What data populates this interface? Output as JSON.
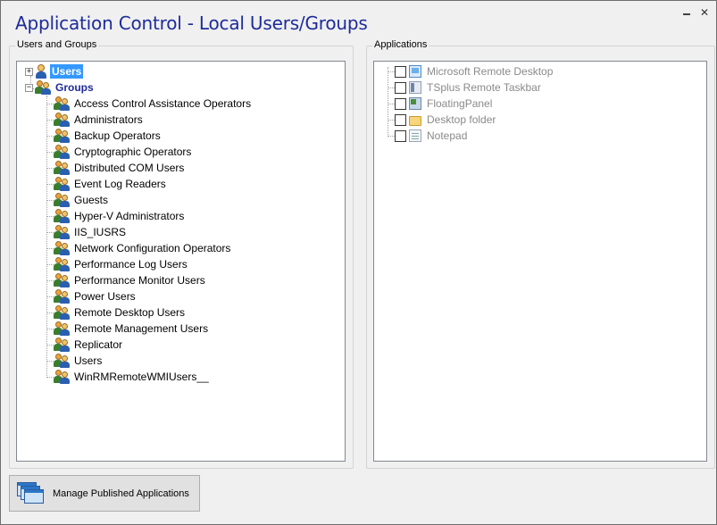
{
  "window": {
    "title": "Application Control - Local Users/Groups"
  },
  "users_groups": {
    "label": "Users and Groups",
    "users_node": "Users",
    "groups_node": "Groups",
    "groups": [
      "Access Control Assistance Operators",
      "Administrators",
      "Backup Operators",
      "Cryptographic Operators",
      "Distributed COM Users",
      "Event Log Readers",
      "Guests",
      "Hyper-V Administrators",
      "IIS_IUSRS",
      "Network Configuration Operators",
      "Performance Log Users",
      "Performance Monitor Users",
      "Power Users",
      "Remote Desktop Users",
      "Remote Management Users",
      "Replicator",
      "Users",
      "WinRMRemoteWMIUsers__"
    ]
  },
  "applications": {
    "label": "Applications",
    "items": [
      {
        "label": "Microsoft Remote Desktop",
        "icon": "remote-desktop-icon",
        "checked": false
      },
      {
        "label": "TSplus Remote Taskbar",
        "icon": "taskbar-icon",
        "checked": false
      },
      {
        "label": "FloatingPanel",
        "icon": "floating-panel-icon",
        "checked": false
      },
      {
        "label": "Desktop folder",
        "icon": "folder-icon",
        "checked": false
      },
      {
        "label": "Notepad",
        "icon": "notepad-icon",
        "checked": false
      }
    ]
  },
  "footer": {
    "manage_button": "Manage Published Applications"
  },
  "colors": {
    "title": "#1d2b9b",
    "selection": "#3399ff"
  }
}
